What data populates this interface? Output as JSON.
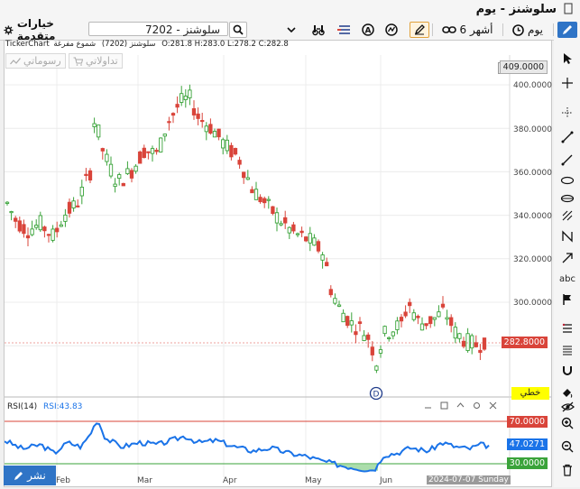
{
  "window": {
    "title": "سلوشنز - يوم"
  },
  "toolbar": {
    "timeframe": "يوم",
    "range": "6 أشهر",
    "symbol_search": "7202 - سلوشنز",
    "advanced_options": "خيارات متقدمة"
  },
  "chart": {
    "brand": "TickerChart",
    "symbol_label": "سلوشنز (7202)",
    "candle_type": "شموع مفرغة",
    "ohlc_text": "O:281.8  H:283.0  L:278.2  C:282.8",
    "trading_button": "تداولاتي",
    "drawings_button": "رسوماتي",
    "price_axis": [
      "400.0000",
      "380.0000",
      "360.0000",
      "340.0000",
      "320.0000",
      "300.0000"
    ],
    "top_price_tag": "409.0000",
    "last_price_tag": "282.8000",
    "line_style_tag": "خطي",
    "dividend_marker": "D"
  },
  "rsi": {
    "label": "RSI(14)",
    "value_text": "RSI:43.83",
    "upper_level": "70.0000",
    "current_value": "47.0271",
    "lower_level": "30.0000"
  },
  "x_axis": {
    "months": [
      "Feb",
      "Mar",
      "Apr",
      "May",
      "Jun"
    ],
    "cursor_date": "2024-07-07 Sunday"
  },
  "share_button": "نشر",
  "colors": {
    "up": "#3aa33a",
    "down": "#d9443a",
    "rsi_line": "#1a73e8",
    "accent": "#2f74c6"
  }
}
